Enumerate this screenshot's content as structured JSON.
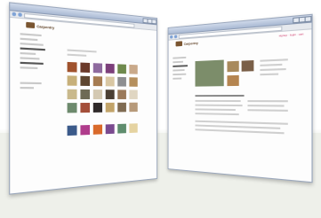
{
  "scene": {
    "floor_color": "#eef0ea",
    "background": "#ffffff"
  },
  "left_window": {
    "logo_text": "Carpentry",
    "sidebar_lines": 10,
    "tiles": [
      "#a0522d",
      "#6b3a2a",
      "#8e6a9e",
      "#7c3f7a",
      "#6f8a4d",
      "#c9a98a",
      "#c7b07a",
      "#5e4630",
      "#a67c52",
      "#d9c7a3",
      "#8e8f91",
      "#b58f5d",
      "#c9b98c",
      "#6e6a55",
      "#d4c9b2",
      "#4b3f33",
      "#9b7a5a",
      "#e0d6c2",
      "#6d8a6d",
      "#a44f3a",
      "#2f2a2a",
      "#c2a46a",
      "#7f6b52",
      "#b79a7a",
      "#3b5a8a",
      "#b03c8c",
      "#d96a2b",
      "#7a4a8f",
      "#5f8d6e",
      "#e5d3a1"
    ]
  },
  "right_window": {
    "logo_text": "Carpentry",
    "header_links": "signup · login · cart",
    "product_images": [
      "#7c8d6a",
      "#a88a5c",
      "#7a5f48",
      "#b58550"
    ]
  }
}
